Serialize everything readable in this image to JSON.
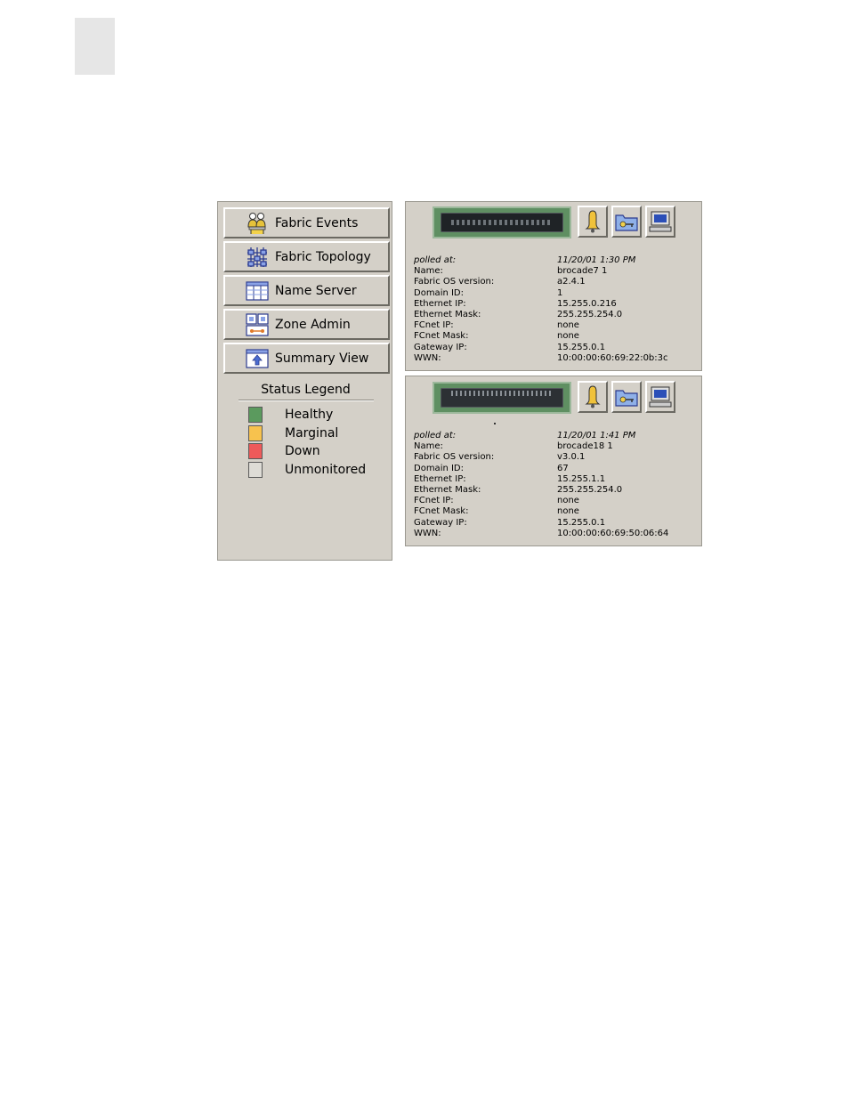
{
  "nav": {
    "buttons": [
      {
        "label": "Fabric Events",
        "icon": "fabric-events-icon"
      },
      {
        "label": "Fabric Topology",
        "icon": "fabric-topology-icon"
      },
      {
        "label": "Name Server",
        "icon": "name-server-icon"
      },
      {
        "label": "Zone Admin",
        "icon": "zone-admin-icon"
      },
      {
        "label": "Summary View",
        "icon": "summary-view-icon"
      }
    ]
  },
  "legend": {
    "title": "Status Legend",
    "items": [
      {
        "label": "Healthy",
        "color": "#5b9a5e"
      },
      {
        "label": "Marginal",
        "color": "#f7c24e"
      },
      {
        "label": "Down",
        "color": "#ee5a5a"
      },
      {
        "label": "Unmonitored",
        "color": "#dedcd6"
      }
    ]
  },
  "switches": [
    {
      "rows": [
        {
          "label": "polled at:",
          "value": "11/20/01 1:30 PM"
        },
        {
          "label": "Name:",
          "value": "brocade7  1"
        },
        {
          "label": "Fabric OS version:",
          "value": "a2.4.1"
        },
        {
          "label": "Domain ID:",
          "value": "1"
        },
        {
          "label": "Ethernet IP:",
          "value": "15.255.0.216"
        },
        {
          "label": "Ethernet Mask:",
          "value": "255.255.254.0"
        },
        {
          "label": "FCnet IP:",
          "value": "none"
        },
        {
          "label": "FCnet Mask:",
          "value": "none"
        },
        {
          "label": "Gateway IP:",
          "value": "15.255.0.1"
        },
        {
          "label": "WWN:",
          "value": "10:00:00:60:69:22:0b:3c"
        }
      ]
    },
    {
      "rows": [
        {
          "label": "polled at:",
          "value": "11/20/01 1:41 PM"
        },
        {
          "label": "Name:",
          "value": "brocade18  1"
        },
        {
          "label": "Fabric OS version:",
          "value": "v3.0.1"
        },
        {
          "label": "Domain ID:",
          "value": "67"
        },
        {
          "label": "Ethernet IP:",
          "value": "15.255.1.1"
        },
        {
          "label": "Ethernet Mask:",
          "value": "255.255.254.0"
        },
        {
          "label": "FCnet IP:",
          "value": "none"
        },
        {
          "label": "FCnet Mask:",
          "value": "none"
        },
        {
          "label": "Gateway IP:",
          "value": "15.255.0.1"
        },
        {
          "label": "WWN:",
          "value": "10:00:00:60:69:50:06:64"
        }
      ]
    }
  ],
  "switch_icons": [
    "bell-icon",
    "admin-folder-icon",
    "telnet-computer-icon"
  ]
}
